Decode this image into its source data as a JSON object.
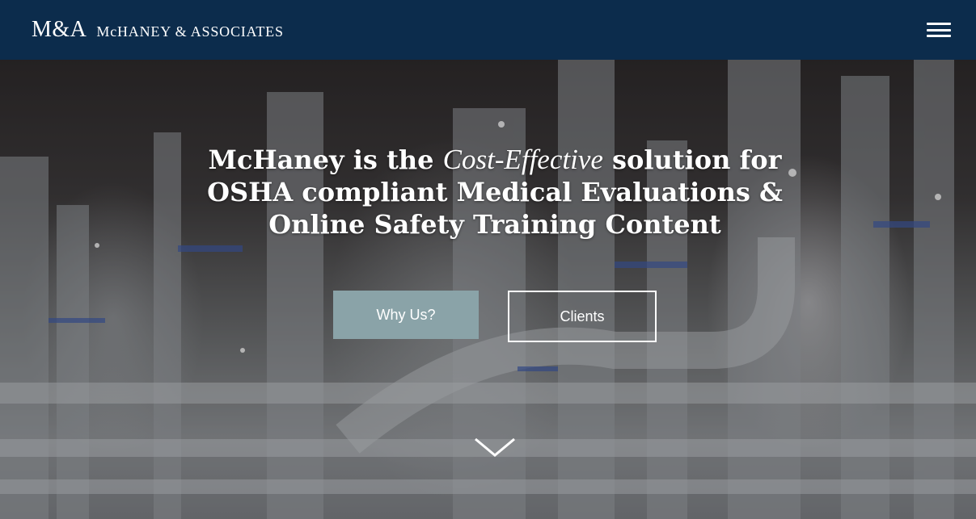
{
  "header": {
    "logo_mark": "M&A",
    "logo_text": "McHANEY & ASSOCIATES",
    "menu_icon": "hamburger-menu-icon"
  },
  "hero": {
    "headline_before": "McHaney is the ",
    "headline_emphasis": "Cost-Effective",
    "headline_after": " solution for OSHA compliant Medical Evaluations & Online Safety Training Content",
    "primary_button": "Why Us?",
    "secondary_button": "Clients",
    "scroll_icon": "chevron-down-icon"
  },
  "colors": {
    "header_bg": "#0c2c4c",
    "primary_button_bg": "#8aa3a8",
    "text": "#ffffff"
  }
}
